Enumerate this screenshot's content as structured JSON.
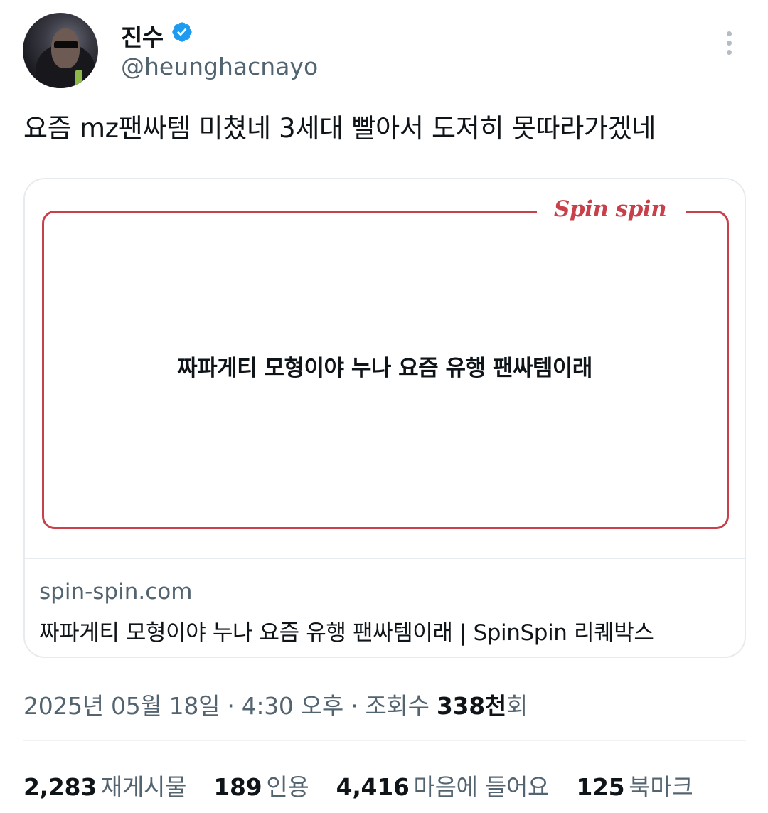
{
  "author": {
    "name": "진수",
    "handle": "@heunghacnayo",
    "verified": true
  },
  "tweet": {
    "text": "요즘 mz팬싸템 미쳤네 3세대 빨아서 도저히 못따라가겠네"
  },
  "card": {
    "logo": "Spin spin",
    "image_caption": "짜파게티 모형이야 누나 요즘 유행 팬싸템이래",
    "domain": "spin-spin.com",
    "title": "짜파게티 모형이야 누나 요즘 유행 팬싸템이래 | SpinSpin 리퀘박스"
  },
  "meta": {
    "date": "2025년 05월 18일",
    "sep1": " · ",
    "time": "4:30 오후",
    "sep2": " · ",
    "views_prefix": "조회수 ",
    "views_value": "338천",
    "views_suffix": "회"
  },
  "stats": [
    {
      "value": "2,283",
      "label": "재게시물"
    },
    {
      "value": "189",
      "label": "인용"
    },
    {
      "value": "4,416",
      "label": "마음에 들어요"
    },
    {
      "value": "125",
      "label": "북마크"
    }
  ],
  "colors": {
    "accent": "#1d9bf0",
    "brand_red": "#c8404a",
    "secondary_text": "#536471"
  },
  "icons": {
    "verified": "verified-badge-icon",
    "more": "more-vertical-icon"
  }
}
